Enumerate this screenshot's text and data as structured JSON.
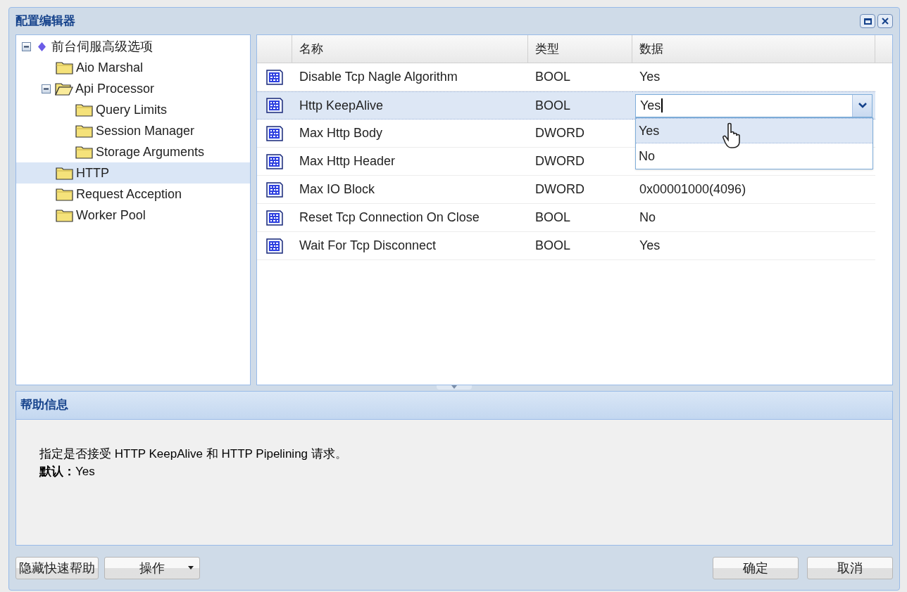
{
  "window": {
    "title": "配置编辑器"
  },
  "tree": [
    {
      "label": "前台伺服高级选项",
      "kind": "root",
      "expanded": true,
      "selected": false,
      "children": [
        {
          "label": "Aio Marshal",
          "kind": "folder",
          "selected": false
        },
        {
          "label": "Api Processor",
          "kind": "folder",
          "expanded": true,
          "selected": false,
          "children": [
            {
              "label": "Query Limits",
              "kind": "folder",
              "selected": false
            },
            {
              "label": "Session Manager",
              "kind": "folder",
              "selected": false
            },
            {
              "label": "Storage Arguments",
              "kind": "folder",
              "selected": false
            }
          ]
        },
        {
          "label": "HTTP",
          "kind": "folder",
          "selected": true
        },
        {
          "label": "Request Acception",
          "kind": "folder",
          "selected": false
        },
        {
          "label": "Worker Pool",
          "kind": "folder",
          "selected": false
        }
      ]
    }
  ],
  "table": {
    "columns": [
      "名称",
      "类型",
      "数据"
    ],
    "rows": [
      {
        "name": "Disable Tcp Nagle Algorithm",
        "type": "BOOL",
        "data": "Yes",
        "selected": false
      },
      {
        "name": "Http KeepAlive",
        "type": "BOOL",
        "selected": true,
        "editor": {
          "value": "Yes",
          "options": [
            {
              "label": "Yes",
              "selected": true
            },
            {
              "label": "No",
              "selected": false
            }
          ]
        }
      },
      {
        "name": "Max Http Body",
        "type": "DWORD",
        "selected": false
      },
      {
        "name": "Max Http Header",
        "type": "DWORD",
        "selected": false
      },
      {
        "name": "Max IO Block",
        "type": "DWORD",
        "data": "0x00001000(4096)",
        "selected": false
      },
      {
        "name": "Reset Tcp Connection On Close",
        "type": "BOOL",
        "data": "No",
        "selected": false
      },
      {
        "name": "Wait For Tcp Disconnect",
        "type": "BOOL",
        "data": "Yes",
        "selected": false
      }
    ]
  },
  "help": {
    "title": "帮助信息",
    "lines": [
      "指定是否接受 HTTP KeepAlive 和 HTTP Pipelining 请求。",
      "**默认：**Yes"
    ]
  },
  "buttons_left": [
    {
      "label": "隐藏快速帮助",
      "kind": "plain"
    },
    {
      "label": "操作",
      "kind": "menu"
    }
  ],
  "buttons_right": [
    {
      "label": "确定"
    },
    {
      "label": "取消"
    }
  ]
}
